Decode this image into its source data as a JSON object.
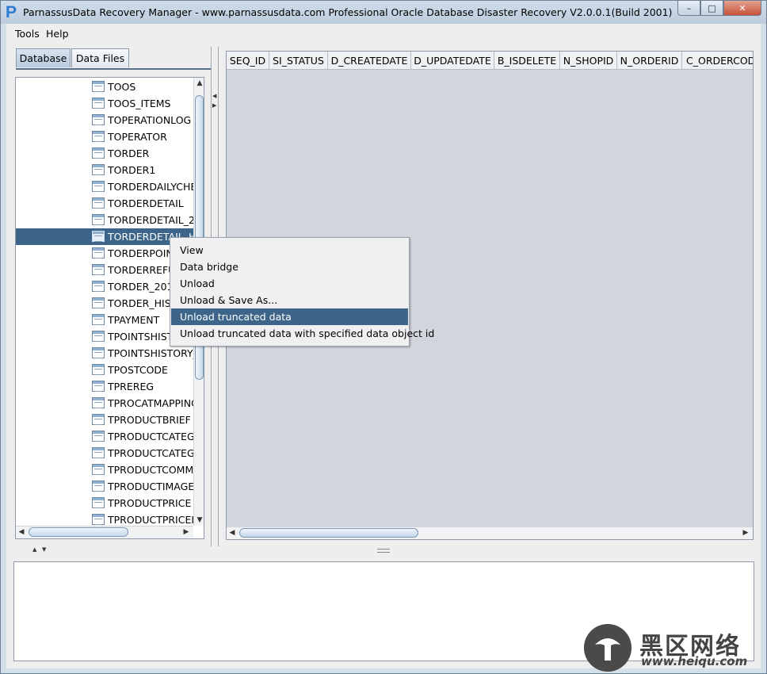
{
  "window": {
    "app_icon": "P",
    "title": "ParnassusData Recovery Manager - www.parnassusdata.com  Professional Oracle Database Disaster Recovery   V2.0.0.1(Build 2001)",
    "controls": [
      "minimize-icon",
      "maximize-icon",
      "close-icon"
    ]
  },
  "menubar": {
    "items": [
      "Tools",
      "Help"
    ]
  },
  "tabs": [
    {
      "label": "Database",
      "active": true
    },
    {
      "label": "Data Files",
      "active": false
    }
  ],
  "tree": {
    "items": [
      {
        "label": "TOOS"
      },
      {
        "label": "TOOS_ITEMS"
      },
      {
        "label": "TOPERATIONLOG"
      },
      {
        "label": "TOPERATOR"
      },
      {
        "label": "TORDER"
      },
      {
        "label": "TORDER1"
      },
      {
        "label": "TORDERDAILYCHE"
      },
      {
        "label": "TORDERDETAIL"
      },
      {
        "label": "TORDERDETAIL_2"
      },
      {
        "label": "TORDERDETAIL_H",
        "selected": true
      },
      {
        "label": "TORDERPOIN"
      },
      {
        "label": "TORDERREFU"
      },
      {
        "label": "TORDER_201"
      },
      {
        "label": "TORDER_HIS"
      },
      {
        "label": "TPAYMENT"
      },
      {
        "label": "TPOINTSHIST"
      },
      {
        "label": "TPOINTSHISTORY_"
      },
      {
        "label": "TPOSTCODE"
      },
      {
        "label": "TPREREG"
      },
      {
        "label": "TPROCATMAPPING"
      },
      {
        "label": "TPRODUCTBRIEF"
      },
      {
        "label": "TPRODUCTCATEG"
      },
      {
        "label": "TPRODUCTCATEG"
      },
      {
        "label": "TPRODUCTCOMME"
      },
      {
        "label": "TPRODUCTIMAGES"
      },
      {
        "label": "TPRODUCTPRICE"
      },
      {
        "label": "TPRODUCTPRICEI"
      }
    ]
  },
  "grid": {
    "columns": [
      "SEQ_ID",
      "SI_STATUS",
      "D_CREATEDATE",
      "D_UPDATEDATE",
      "B_ISDELETE",
      "N_SHOPID",
      "N_ORDERID",
      "C_ORDERCOD"
    ]
  },
  "context_menu": {
    "items": [
      {
        "label": "View"
      },
      {
        "label": "Data bridge"
      },
      {
        "label": "Unload"
      },
      {
        "label": "Unload & Save As..."
      },
      {
        "label": "Unload truncated data",
        "highlighted": true
      },
      {
        "label": "Unload truncated data with specified data object id"
      }
    ]
  },
  "watermark": {
    "cn": "黑区网络",
    "url": "www.heiqu.com"
  },
  "colors": {
    "selection": "#3d6589",
    "titlebar": "#c5d4e4",
    "grid_bg": "#d2d5db"
  }
}
